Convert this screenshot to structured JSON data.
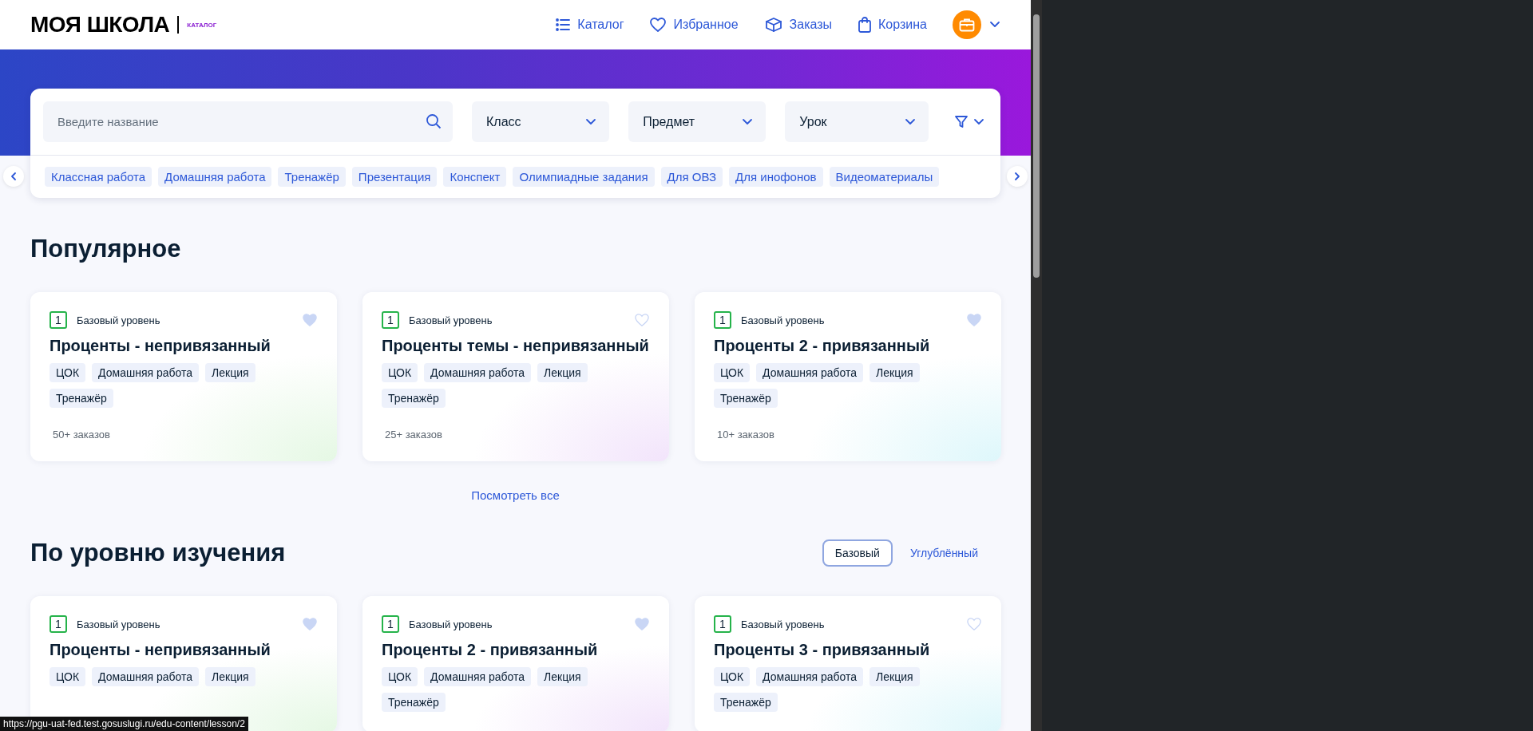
{
  "header": {
    "logo": "МОЯ ШКОЛА",
    "logo_caption": "КАТАЛОГ",
    "nav": [
      {
        "label": "Каталог"
      },
      {
        "label": "Избранное"
      },
      {
        "label": "Заказы"
      },
      {
        "label": "Корзина"
      }
    ]
  },
  "filters": {
    "search": {
      "placeholder": "Введите название"
    },
    "selects": [
      "Класс",
      "Предмет",
      "Урок"
    ],
    "chips": [
      "Классная работа",
      "Домашняя работа",
      "Тренажёр",
      "Презентация",
      "Конспект",
      "Олимпиадные задания",
      "Для ОВЗ",
      "Для инофонов",
      "Видеоматериалы"
    ]
  },
  "sections": [
    {
      "title": "Популярное",
      "cards": [
        {
          "grade": "1",
          "level": "Базовый уровень",
          "title": "Проценты - непривязанный",
          "favorite": true,
          "tags": [
            "ЦОК",
            "Домашняя работа",
            "Лекция",
            "Тренажёр"
          ],
          "orders": "50+ заказов"
        },
        {
          "grade": "1",
          "level": "Базовый уровень",
          "title": "Проценты темы - непривязанный",
          "favorite": false,
          "tags": [
            "ЦОК",
            "Домашняя работа",
            "Лекция",
            "Тренажёр"
          ],
          "orders": "25+ заказов"
        },
        {
          "grade": "1",
          "level": "Базовый уровень",
          "title": "Проценты 2 - привязанный",
          "favorite": true,
          "tags": [
            "ЦОК",
            "Домашняя работа",
            "Лекция",
            "Тренажёр"
          ],
          "orders": "10+ заказов"
        }
      ],
      "see_all": "Посмотреть все"
    },
    {
      "title": "По уровню изучения",
      "toggle": [
        {
          "label": "Базовый",
          "selected": true
        },
        {
          "label": "Углублённый",
          "selected": false
        }
      ],
      "cards": [
        {
          "grade": "1",
          "level": "Базовый уровень",
          "title": "Проценты - непривязанный",
          "favorite": true,
          "tags": [
            "ЦОК",
            "Домашняя работа",
            "Лекция"
          ]
        },
        {
          "grade": "1",
          "level": "Базовый уровень",
          "title": "Проценты 2 - привязанный",
          "favorite": true,
          "tags": [
            "ЦОК",
            "Домашняя работа",
            "Лекция",
            "Тренажёр"
          ]
        },
        {
          "grade": "1",
          "level": "Базовый уровень",
          "title": "Проценты 3 - привязанный",
          "favorite": false,
          "tags": [
            "ЦОК",
            "Домашняя работа",
            "Лекция",
            "Тренажёр"
          ]
        }
      ]
    }
  ],
  "status_bar": {
    "url": "https://pgu-uat-fed.test.gosuslugi.ru/edu-content/lesson/2"
  }
}
